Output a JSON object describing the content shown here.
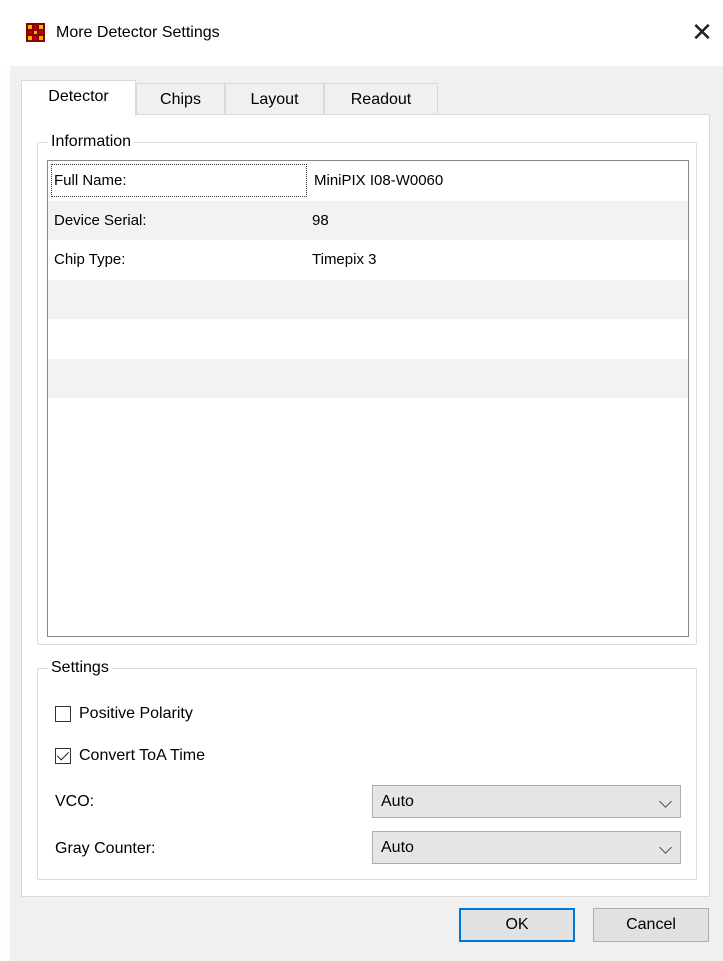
{
  "window": {
    "title": "More Detector Settings",
    "close_symbol": "✕"
  },
  "tabs": [
    {
      "label": "Detector",
      "active": true
    },
    {
      "label": "Chips",
      "active": false
    },
    {
      "label": "Layout",
      "active": false
    },
    {
      "label": "Readout",
      "active": false
    }
  ],
  "information": {
    "title": "Information",
    "rows": [
      {
        "key": "Full Name:",
        "value": "MiniPIX I08-W0060"
      },
      {
        "key": "Device Serial:",
        "value": "98"
      },
      {
        "key": "Chip Type:",
        "value": "Timepix 3"
      },
      {
        "key": "",
        "value": ""
      },
      {
        "key": "",
        "value": ""
      },
      {
        "key": "",
        "value": ""
      }
    ]
  },
  "settings": {
    "title": "Settings",
    "positive_polarity": {
      "label": "Positive Polarity",
      "checked": false
    },
    "convert_toa": {
      "label": "Convert ToA Time",
      "checked": true
    },
    "vco": {
      "label": "VCO:",
      "value": "Auto"
    },
    "gray_counter": {
      "label": "Gray Counter:",
      "value": "Auto"
    }
  },
  "buttons": {
    "ok": "OK",
    "cancel": "Cancel"
  },
  "icons": {
    "app": "detector-grid-icon",
    "close": "close-icon",
    "dropdown": "chevron-down-icon"
  },
  "colors": {
    "accent": "#0078d7",
    "app_icon_red": "#8b0000",
    "app_icon_yellow": "#e8c000"
  }
}
